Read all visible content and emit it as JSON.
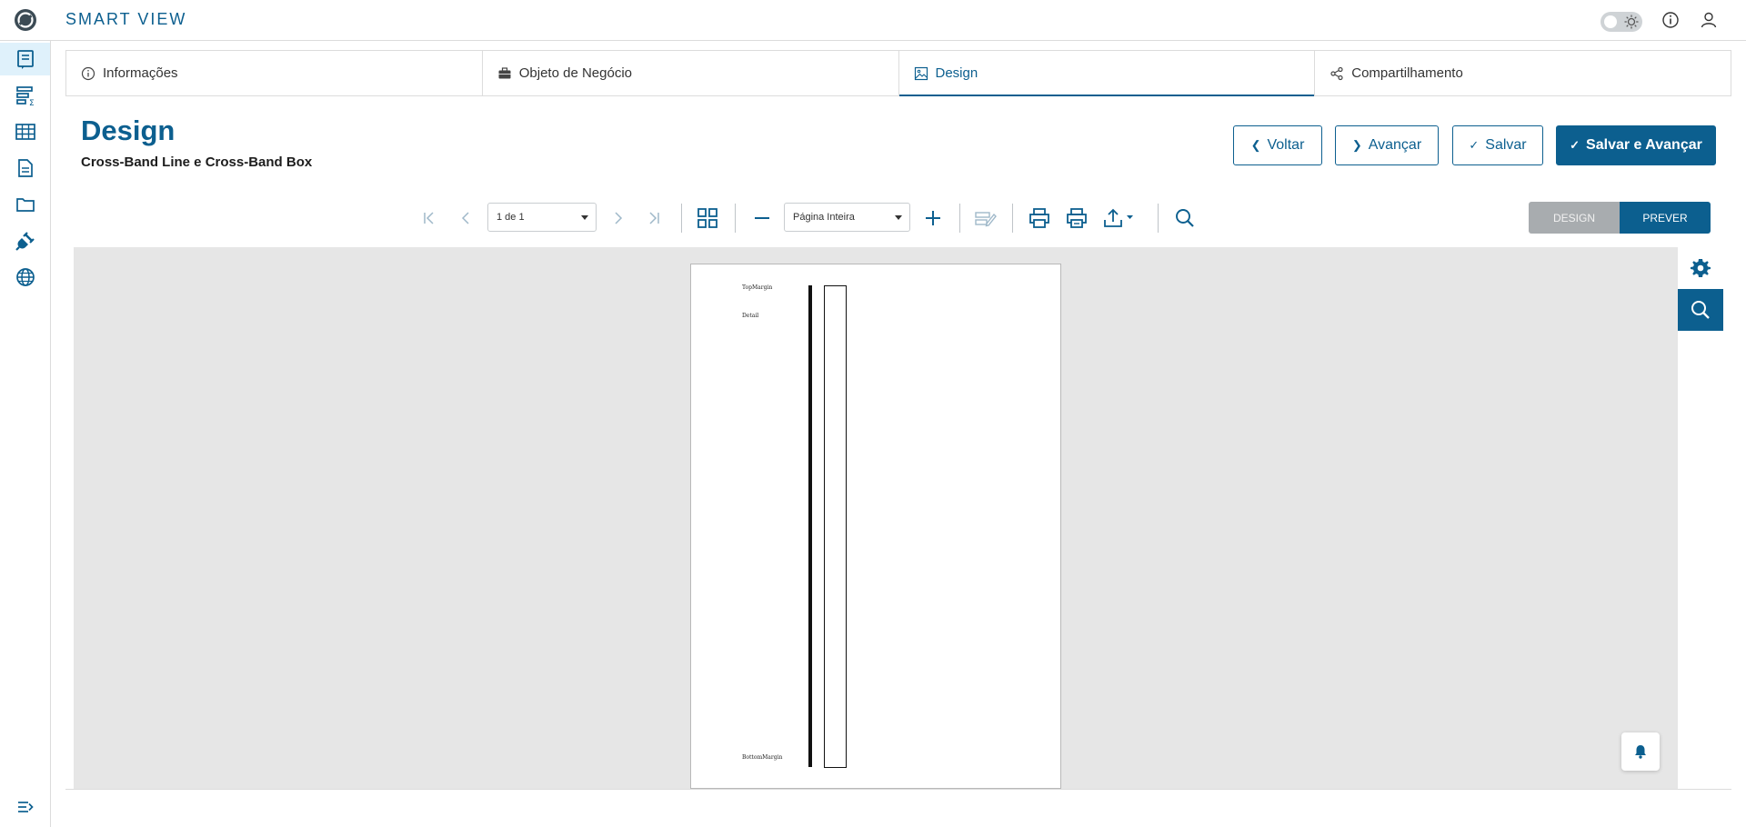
{
  "app": {
    "title": "SMART VIEW"
  },
  "colors": {
    "brand": "#0c5f8f",
    "active_bg": "#dff1fb",
    "preview_bg": "#e6e6e6"
  },
  "header": {
    "icons": [
      "theme-toggle-icon",
      "info-icon",
      "user-icon"
    ]
  },
  "sidebar": {
    "items": [
      {
        "icon": "report-icon",
        "active": true
      },
      {
        "icon": "analysis-icon"
      },
      {
        "icon": "table-icon"
      },
      {
        "icon": "document-icon"
      },
      {
        "icon": "folder-icon"
      },
      {
        "icon": "plug-icon"
      },
      {
        "icon": "globe-icon"
      }
    ],
    "collapse_icon": "expand-menu-icon"
  },
  "tabs": [
    {
      "label": "Informações",
      "icon": "info-icon"
    },
    {
      "label": "Objeto de Negócio",
      "icon": "briefcase-icon"
    },
    {
      "label": "Design",
      "icon": "image-icon",
      "active": true
    },
    {
      "label": "Compartilhamento",
      "icon": "share-icon"
    }
  ],
  "page": {
    "title": "Design",
    "subtitle": "Cross-Band Line e Cross-Band Box"
  },
  "actions": {
    "back": "Voltar",
    "next": "Avançar",
    "save": "Salvar",
    "save_next": "Salvar e Avançar"
  },
  "toolbar": {
    "page_select": "1 de 1",
    "zoom_select": "Página Inteira",
    "mode_design": "DESIGN",
    "mode_preview": "PREVER"
  },
  "report": {
    "bands": {
      "top_margin": "TopMargin",
      "detail": "Detail",
      "bottom_margin": "BottomMargin"
    }
  }
}
